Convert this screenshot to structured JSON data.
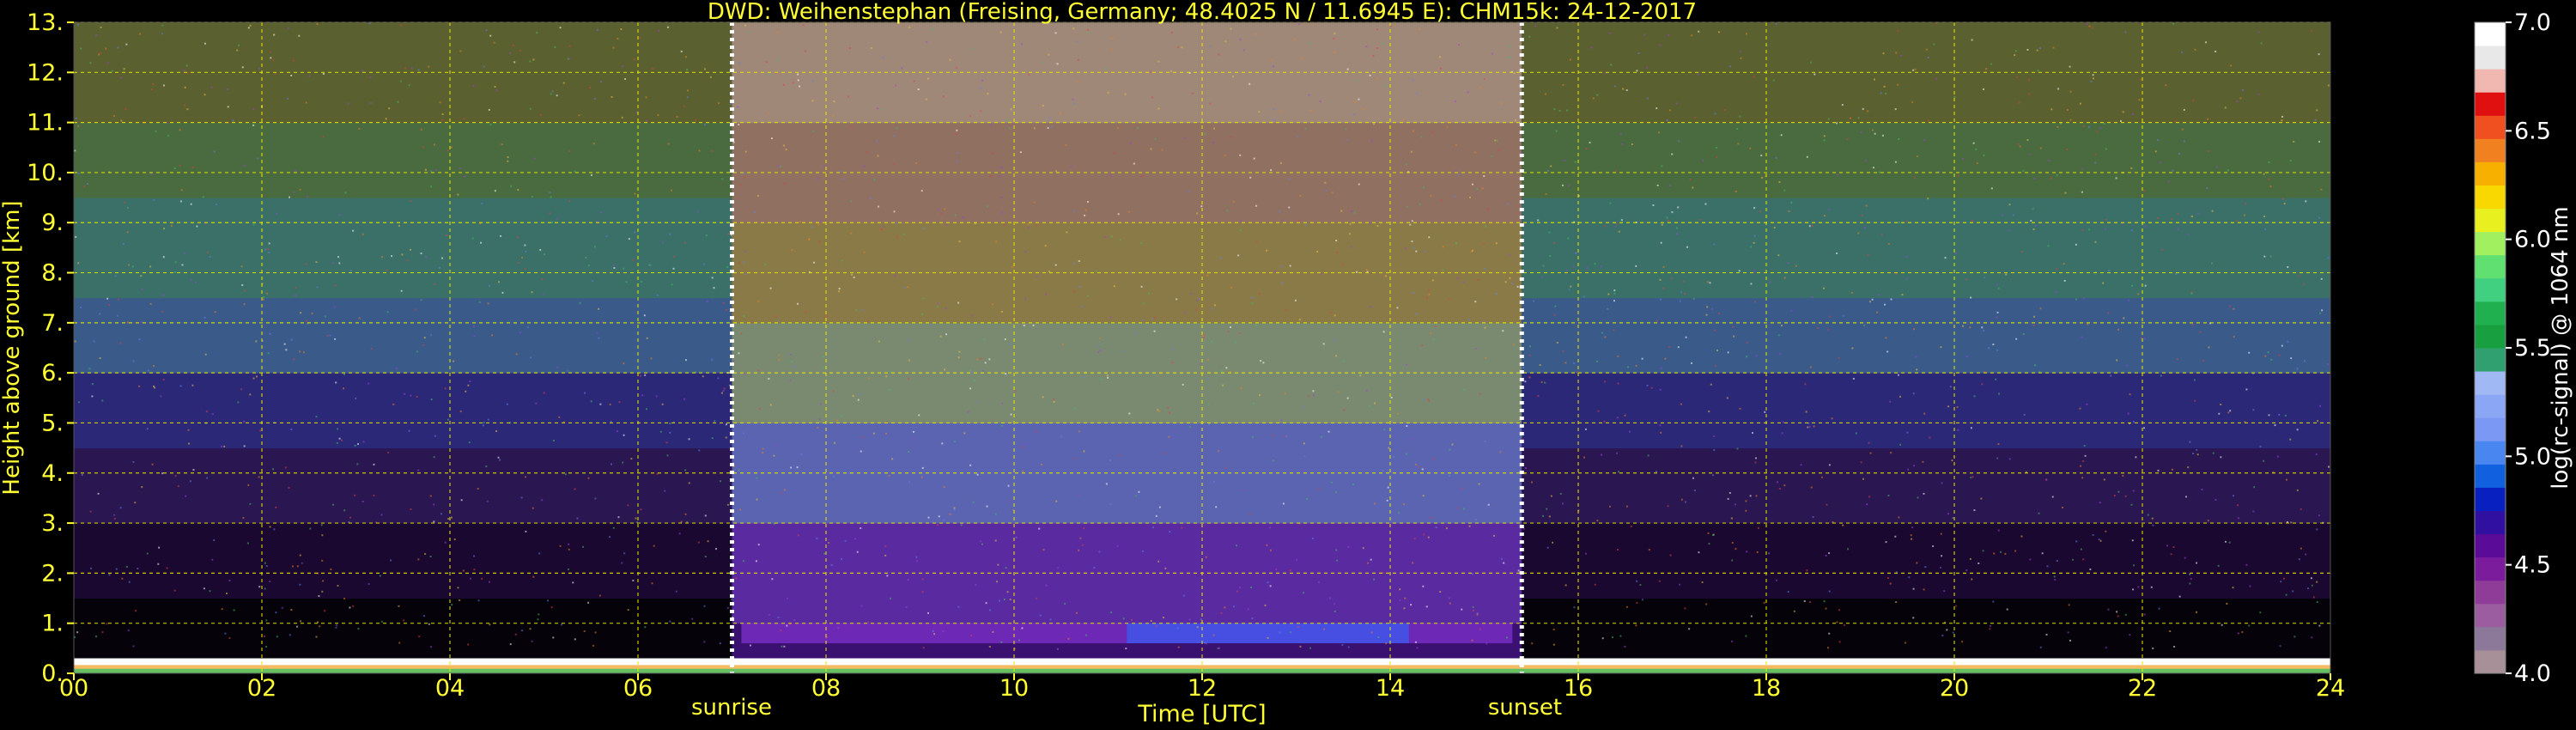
{
  "chart_data": {
    "type": "heatmap",
    "title": "DWD: Weihenstephan (Freising, Germany; 48.4025 N / 11.6945 E):    CHM15k: 24-12-2017",
    "xlabel": "Time [UTC]",
    "ylabel": "Height above ground [km]",
    "xlim": [
      0,
      24
    ],
    "ylim": [
      0,
      13
    ],
    "x_ticks": [
      "00",
      "02",
      "04",
      "06",
      "08",
      "10",
      "12",
      "14",
      "16",
      "18",
      "20",
      "22",
      "24"
    ],
    "y_ticks": [
      "0.",
      "1.",
      "2.",
      "3.",
      "4.",
      "5.",
      "6.",
      "7.",
      "8.",
      "9.",
      "10.",
      "11.",
      "12.",
      "13."
    ],
    "grid": true,
    "sunrise": {
      "label": "sunrise",
      "time_utc": 7.0
    },
    "sunset": {
      "label": "sunset",
      "time_utc": 15.4
    },
    "colorbar": {
      "label": "log(rc-signal) @ 1064 nm",
      "min": 4.0,
      "max": 7.0,
      "ticks": [
        "4.0",
        "4.5",
        "5.0",
        "5.5",
        "6.0",
        "6.5",
        "7.0"
      ],
      "colors": [
        "#a89098",
        "#8c7898",
        "#9c5ca0",
        "#8e3c98",
        "#7a1c9c",
        "#5a0c98",
        "#3010a0",
        "#0820c0",
        "#1060e0",
        "#4a86f0",
        "#7a98f4",
        "#8aa6f4",
        "#a0b8f4",
        "#30a070",
        "#18a040",
        "#20b050",
        "#40d080",
        "#60e070",
        "#a0f060",
        "#e8f020",
        "#f8d800",
        "#f8b000",
        "#f08020",
        "#f05020",
        "#e01010",
        "#f0b8b0",
        "#e8e8e8",
        "#ffffff"
      ]
    },
    "profiles": [
      {
        "period": "night-morning",
        "t_start": 0.0,
        "t_end": 7.0
      },
      {
        "period": "day",
        "t_start": 7.0,
        "t_end": 15.4
      },
      {
        "period": "night-evening",
        "t_start": 15.4,
        "t_end": 24.0
      }
    ],
    "features": [
      {
        "name": "boundary-layer",
        "height_km_top": 0.3
      },
      {
        "name": "daytime-aerosol-layer",
        "height_km_bottom": 0.6,
        "height_km_top": 1.0
      }
    ]
  }
}
